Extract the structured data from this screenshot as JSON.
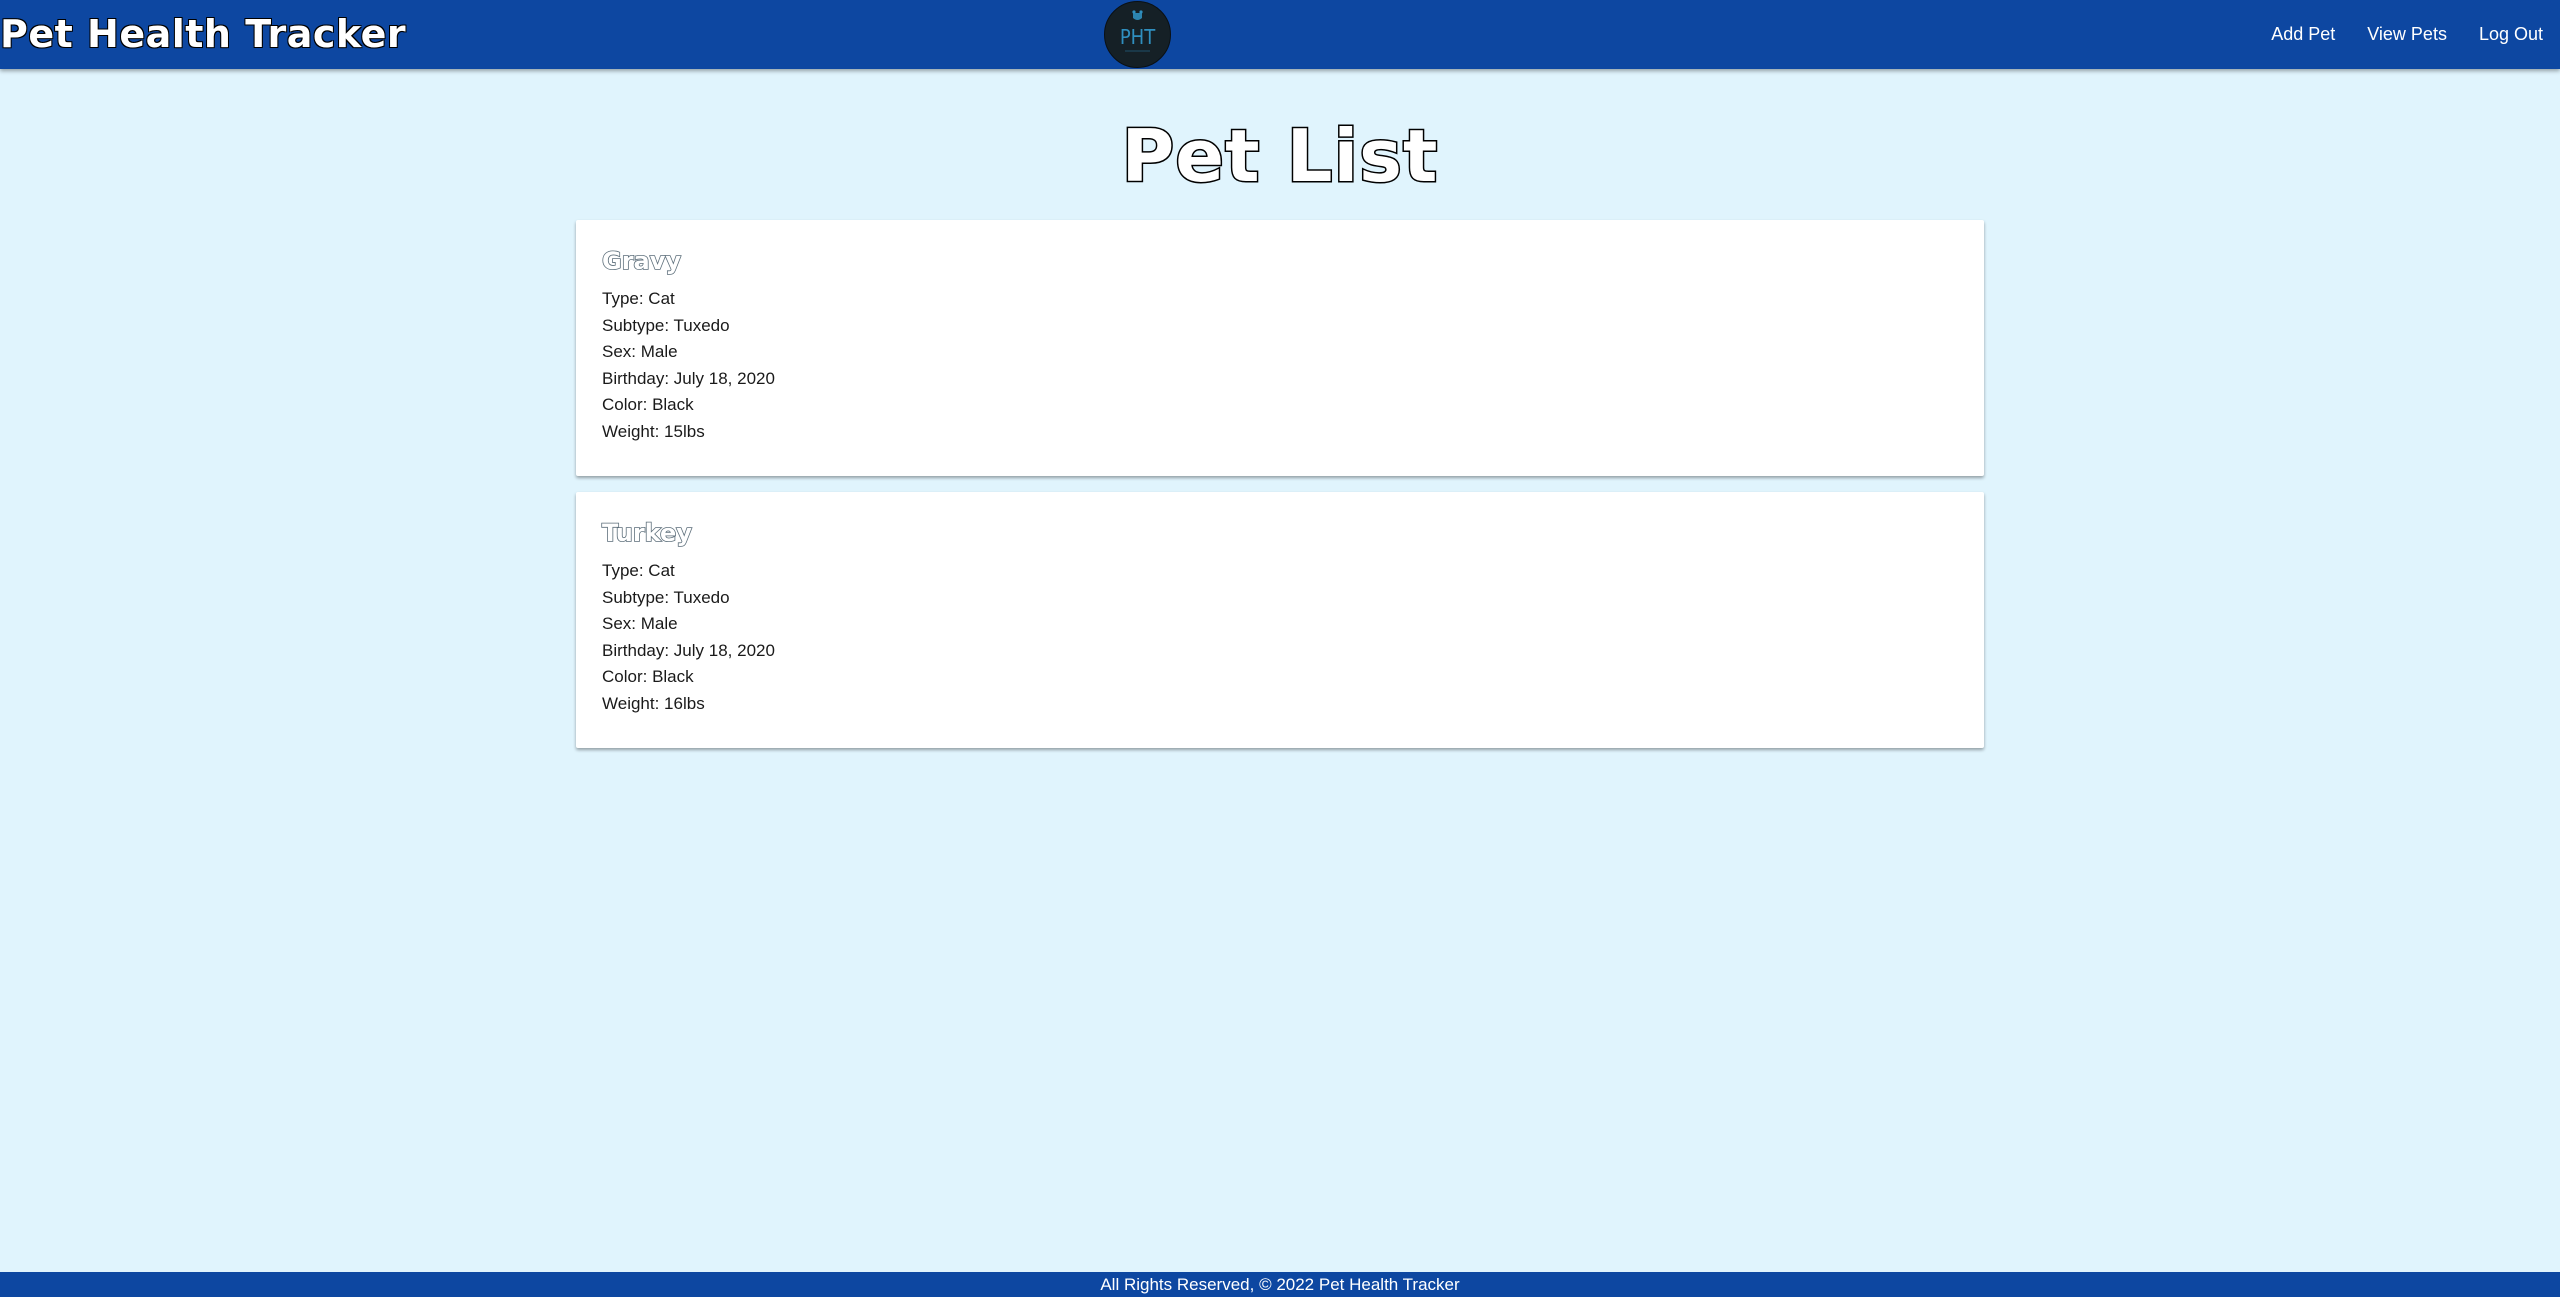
{
  "header": {
    "brand": "Pet Health Tracker",
    "logo_text": "PHT",
    "nav": [
      {
        "label": "Add Pet"
      },
      {
        "label": "View Pets"
      },
      {
        "label": "Log Out"
      }
    ]
  },
  "main": {
    "title": "Pet List",
    "pets": [
      {
        "name": "Gravy",
        "type": "Type: Cat",
        "subtype": "Subtype: Tuxedo",
        "sex": "Sex: Male",
        "birthday": "Birthday: July 18, 2020",
        "color": "Color: Black",
        "weight": "Weight: 15lbs"
      },
      {
        "name": "Turkey",
        "type": "Type: Cat",
        "subtype": "Subtype: Tuxedo",
        "sex": "Sex: Male",
        "birthday": "Birthday: July 18, 2020",
        "color": "Color: Black",
        "weight": "Weight: 16lbs"
      }
    ]
  },
  "footer": {
    "text": "All Rights Reserved, © 2022 Pet Health Tracker"
  },
  "colors": {
    "navbar": "#0d47a1",
    "background": "#e0f4fd",
    "card": "#ffffff",
    "logo_bg": "#152026",
    "logo_accent": "#2f8fbf"
  }
}
